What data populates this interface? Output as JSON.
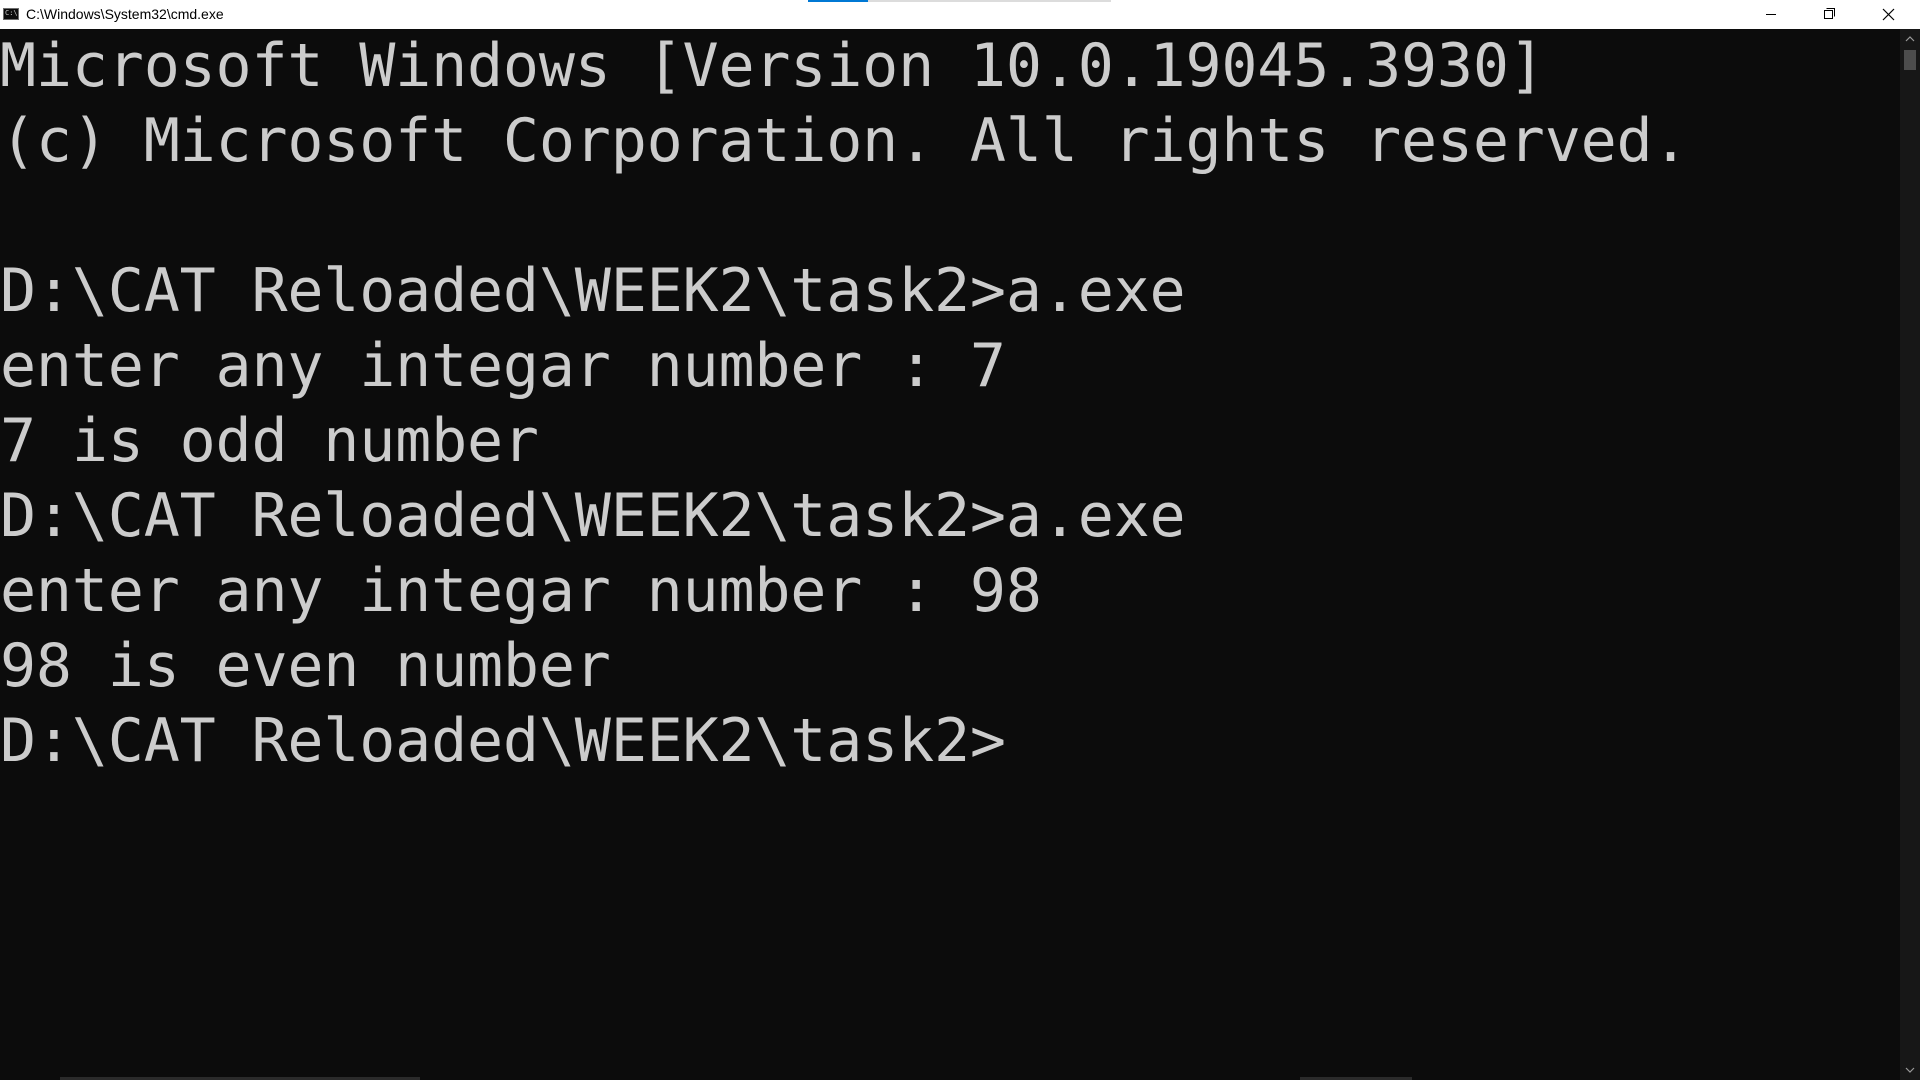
{
  "window": {
    "title": "C:\\Windows\\System32\\cmd.exe",
    "icon": "cmd-app-icon",
    "icon_glyph": "C:\\",
    "controls": {
      "minimize": "minimize-icon",
      "restore": "restore-icon",
      "close": "close-icon"
    }
  },
  "colors": {
    "background": "#0c0c0c",
    "foreground": "#cccccc",
    "titlebar": "#ffffff",
    "accent": "#0078d4"
  },
  "console": {
    "lines": [
      "Microsoft Windows [Version 10.0.19045.3930]",
      "(c) Microsoft Corporation. All rights reserved.",
      "",
      "D:\\CAT Reloaded\\WEEK2\\task2>a.exe",
      "enter any integar number : 7",
      "7 is odd number",
      "D:\\CAT Reloaded\\WEEK2\\task2>a.exe",
      "enter any integar number : 98",
      "98 is even number",
      "D:\\CAT Reloaded\\WEEK2\\task2>"
    ]
  }
}
